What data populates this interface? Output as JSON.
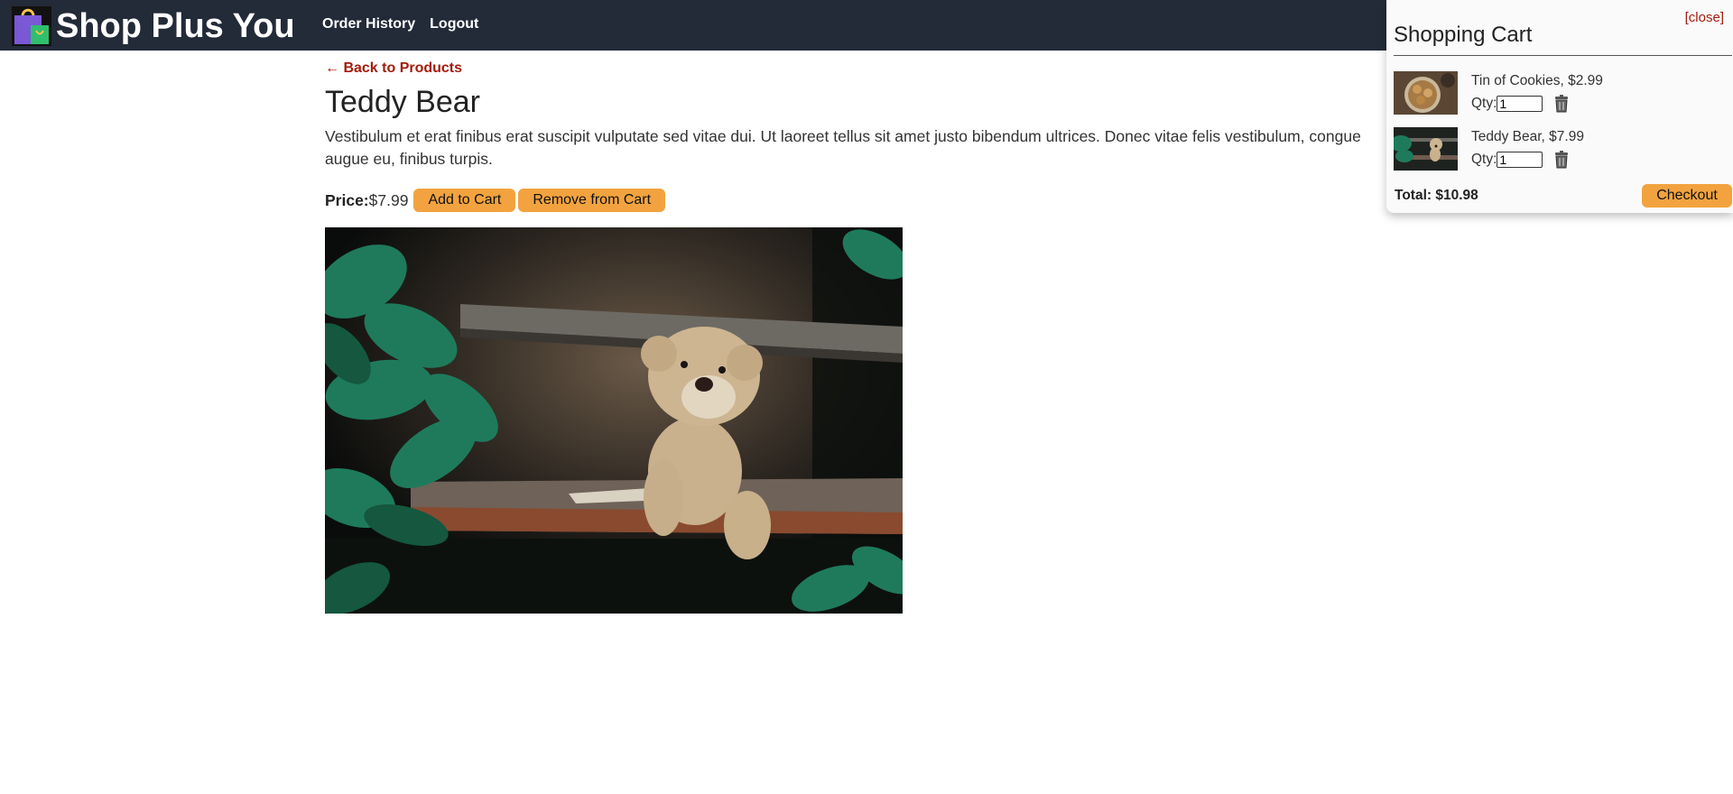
{
  "header": {
    "brand_title": "Shop Plus You",
    "nav": {
      "order_history": "Order History",
      "logout": "Logout"
    },
    "bg_color": "#232a38"
  },
  "product": {
    "back_link": "← Back to Products",
    "title": "Teddy Bear",
    "description": "Vestibulum et erat finibus erat suscipit vulputate sed vitae dui. Ut laoreet tellus sit amet justo bibendum ultrices. Donec vitae felis vestibulum, congue augue eu, finibus turpis.",
    "price_label": "Price:",
    "price_value": "$7.99",
    "add_button": "Add to Cart",
    "remove_button": "Remove from Cart",
    "image": "teddy-bear-photo"
  },
  "cart": {
    "close_label": "[close]",
    "title": "Shopping Cart",
    "qty_label": "Qty:",
    "items": [
      {
        "name": "Tin of Cookies, $2.99",
        "qty": "1",
        "thumb": "cookies-thumbnail"
      },
      {
        "name": "Teddy Bear, $7.99",
        "qty": "1",
        "thumb": "teddy-bear-thumbnail"
      }
    ],
    "total": "Total: $10.98",
    "checkout_button": "Checkout"
  },
  "colors": {
    "accent_button": "#f2a33f",
    "link_red": "#a31b0b"
  }
}
